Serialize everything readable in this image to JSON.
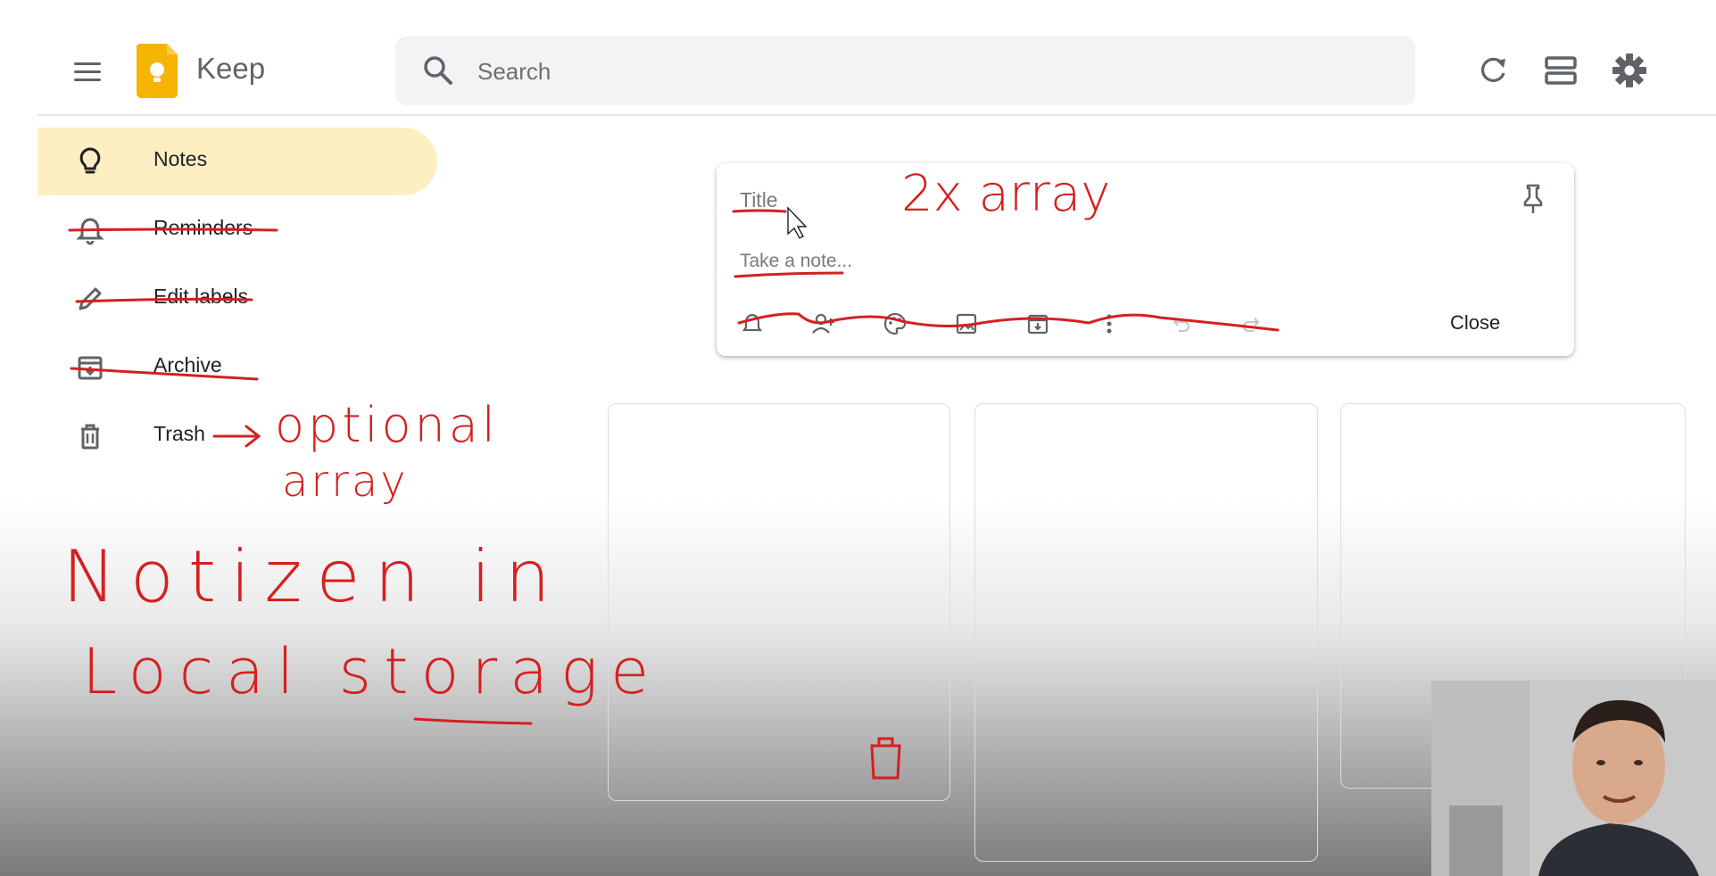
{
  "header": {
    "app_name": "Keep",
    "search_placeholder": "Search"
  },
  "sidebar": {
    "items": [
      {
        "label": "Notes",
        "icon": "lightbulb-icon",
        "active": true
      },
      {
        "label": "Reminders",
        "icon": "bell-icon"
      },
      {
        "label": "Edit labels",
        "icon": "pencil-icon"
      },
      {
        "label": "Archive",
        "icon": "archive-icon"
      },
      {
        "label": "Trash",
        "icon": "trash-icon"
      }
    ]
  },
  "editor": {
    "title_placeholder": "Title",
    "note_placeholder": "Take a note...",
    "close_label": "Close"
  },
  "annotations": {
    "title_note": "2x array",
    "trash_note_line1": "optional",
    "trash_note_line2": "array",
    "storage_line1": "Notizen in",
    "storage_line2": "Local storage"
  },
  "colors": {
    "annotation_red": "#d42020",
    "active_nav_bg": "#feefc3",
    "logo_yellow": "#f4b400",
    "search_bg": "#f1f3f4"
  }
}
